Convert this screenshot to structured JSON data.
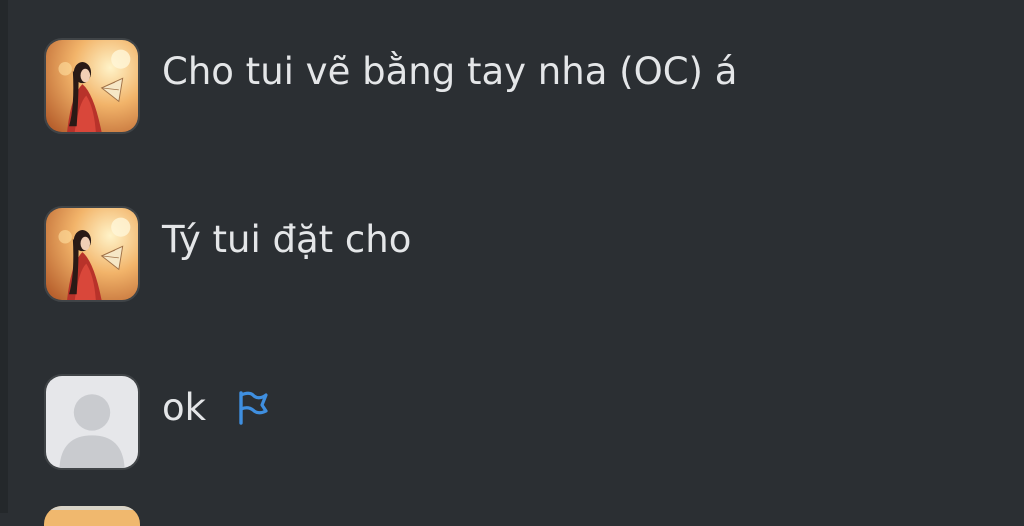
{
  "messages": [
    {
      "text": "Cho tui vẽ bằng tay nha (OC) á",
      "avatar": "character-avatar"
    },
    {
      "text": "Tý tui đặt cho",
      "avatar": "character-avatar"
    },
    {
      "text": "ok",
      "avatar": "default-user-avatar",
      "flag_icon": "flag-icon"
    }
  ],
  "colors": {
    "background": "#2b2f33",
    "text": "#e4e6e8",
    "flag": "#3f8fe0"
  }
}
